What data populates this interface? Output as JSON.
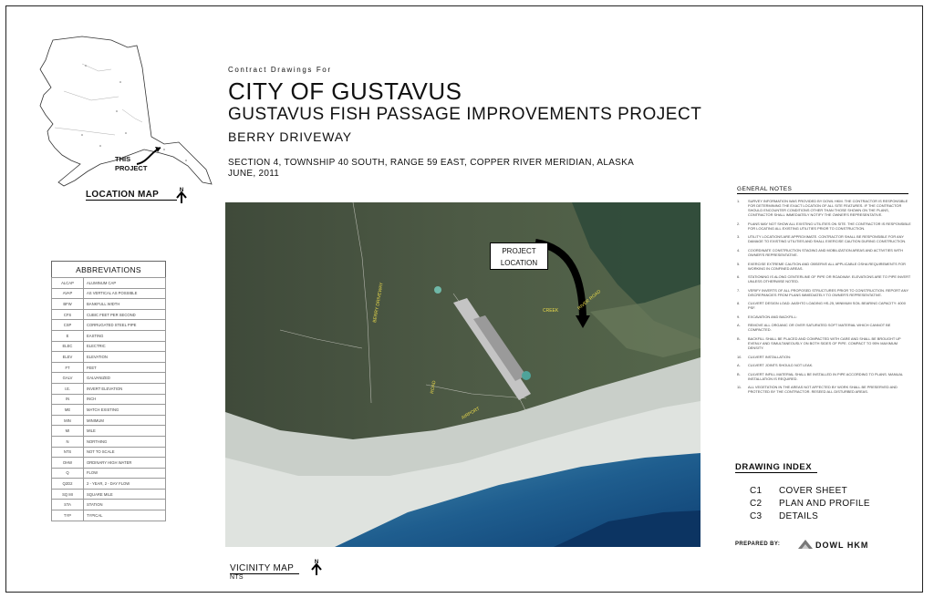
{
  "title_block": {
    "contract": "Contract Drawings For",
    "city": "CITY OF GUSTAVUS",
    "project": "GUSTAVUS FISH PASSAGE IMPROVEMENTS PROJECT",
    "location": "BERRY DRIVEWAY",
    "section": "SECTION 4, TOWNSHIP 40 SOUTH,  RANGE 59 EAST, COPPER RIVER MERIDIAN, ALASKA",
    "date": "JUNE, 2011"
  },
  "location_map": {
    "title": "LOCATION MAP",
    "marker_line1": "THIS",
    "marker_line2": "PROJECT",
    "north_icon": "north-arrow-icon",
    "north_label": "N"
  },
  "abbreviations": {
    "title": "ABBREVIATIONS",
    "rows": [
      [
        "ALCAP",
        "ALUMINUM CAP"
      ],
      [
        "AVAP",
        "AS VERTICAL AS POSSIBLE"
      ],
      [
        "BFW",
        "BANKFULL WIDTH"
      ],
      [
        "CFS",
        "CUBIC FEET PER SECOND"
      ],
      [
        "CSP",
        "CORRUGATED STEEL PIPE"
      ],
      [
        "E",
        "EASTING"
      ],
      [
        "ELEC",
        "ELECTRIC"
      ],
      [
        "ELEV",
        "ELEVATION"
      ],
      [
        "FT",
        "FEET"
      ],
      [
        "GALV",
        "GALVANIZED"
      ],
      [
        "I.E.",
        "INVERT ELEVATION"
      ],
      [
        "IN",
        "INCH"
      ],
      [
        "ME",
        "MATCH EXISTING"
      ],
      [
        "MIN",
        "MINIMUM"
      ],
      [
        "MI",
        "MILE"
      ],
      [
        "N",
        "NORTHING"
      ],
      [
        "NTS",
        "NOT TO SCALE"
      ],
      [
        "OHW",
        "ORDINARY HIGH WATER"
      ],
      [
        "Q",
        "FLOW"
      ],
      [
        "Q2D2",
        "2 - YEAR, 2 - DAY FLOW"
      ],
      [
        "SQ MI",
        "SQUARE MILE"
      ],
      [
        "STA",
        "STATION"
      ],
      [
        "TYP",
        "TYPICAL"
      ]
    ]
  },
  "vicinity_map": {
    "title": "VICINITY MAP",
    "subtitle": "NTS",
    "callout_line1": "PROJECT",
    "callout_line2": "LOCATION",
    "north_label": "N"
  },
  "general_notes": {
    "title": "GENERAL NOTES",
    "items": [
      {
        "n": "1.",
        "t": "SURVEY INFORMATION WAS PROVIDED BY DOWL HKM. THE CONTRACTOR IS RESPONSIBLE FOR DETERMINING THE EXACT LOCATION OF ALL SITE FEATURES. IF THE CONTRACTOR SHOULD ENCOUNTER CONDITIONS OTHER THAN THOSE SHOWN ON THE PLANS, CONTRACTOR SHALL IMMEDIATELY NOTIFY THE OWNER'S REPRESENTATIVE."
      },
      {
        "n": "2.",
        "t": "PLANS MAY NOT SHOW ALL EXISTING UTILITIES ON SITE. THE CONTRACTOR IS RESPONSIBLE FOR LOCATING ALL EXISTING UTILITIES PRIOR TO CONSTRUCTION."
      },
      {
        "n": "3.",
        "t": "UTILITY LOCATIONS ARE APPROXIMATE. CONTRACTOR SHALL BE RESPONSIBLE FOR ANY DAMAGE TO EXISTING UTILITIES AND SHALL EXERCISE CAUTION DURING CONSTRUCTION."
      },
      {
        "n": "4.",
        "t": "COORDINATE CONSTRUCTION STAGING AND MOBILIZATION AREAS AND ACTIVITIES WITH OWNER'S REPRESENTATIVE."
      },
      {
        "n": "5.",
        "t": "EXERCISE EXTREME CAUTION AND OBSERVE ALL APPLICABLE OSHA REQUIREMENTS FOR WORKING IN CONFINED AREAS."
      },
      {
        "n": "6.",
        "t": "STATIONING IS ALONG CENTERLINE OF PIPE OR ROADWAY. ELEVATIONS ARE TO PIPE INVERT UNLESS OTHERWISE NOTED."
      },
      {
        "n": "7.",
        "t": "VERIFY INVERTS OF ALL PROPOSED STRUCTURES PRIOR TO CONSTRUCTION. REPORT ANY DISCREPANCIES FROM PLANS IMMEDIATELY TO OWNER'S REPRESENTATIVE."
      },
      {
        "n": "8.",
        "t": "CULVERT DESIGN LOAD: AASHTO LOADING HS-25, MINIMUM SOIL BEARING CAPACITY: 4000 PSF."
      },
      {
        "n": "9.",
        "t": "EXCAVATION AND BACKFILL:"
      },
      {
        "n": "A.",
        "t": "REMOVE ALL ORGANIC OR OVER SATURATED SOFT MATERIAL WHICH CANNOT BE COMPACTED."
      },
      {
        "n": "B.",
        "t": "BACKFILL SHALL BE PLACED AND COMPACTED WITH CARE AND SHALL BE BROUGHT UP EVENLY AND SIMULTANEOUSLY ON BOTH SIDES OF PIPE. COMPACT TO 95% MAXIMUM DENSITY."
      },
      {
        "n": "10.",
        "t": "CULVERT INSTALLATION:"
      },
      {
        "n": "A.",
        "t": "CULVERT JOINTS SHOULD NOT LEAK."
      },
      {
        "n": "B.",
        "t": "CULVERT INFILL MATERIAL SHALL BE INSTALLED IN PIPE ACCORDING TO PLANS. MANUAL INSTALLATION IS REQUIRED."
      },
      {
        "n": "11.",
        "t": "ALL VEGETATION IN THE AREAS NOT AFFECTED BY WORK SHALL BE PRESERVED AND PROTECTED BY THE CONTRACTOR. RESEED ALL DISTURBED AREAS."
      }
    ]
  },
  "drawing_index": {
    "title": "DRAWING INDEX",
    "items": [
      {
        "code": "C1",
        "name": "COVER SHEET"
      },
      {
        "code": "C2",
        "name": "PLAN AND PROFILE"
      },
      {
        "code": "C3",
        "name": "DETAILS"
      }
    ]
  },
  "prepared_by": {
    "label": "PREPARED BY:",
    "firm": "DOWL HKM"
  }
}
